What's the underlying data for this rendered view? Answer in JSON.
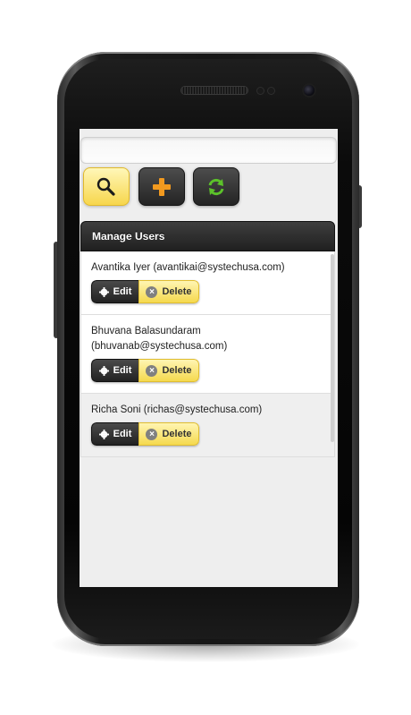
{
  "toolbar": {
    "search_icon": "search-icon",
    "add_icon": "plus-icon",
    "refresh_icon": "refresh-icon"
  },
  "panel": {
    "title": "Manage Users"
  },
  "users": [
    {
      "line1": "Avantika Iyer (avantikai@systechusa.com)",
      "line2": "",
      "edit_label": "Edit",
      "delete_label": "Delete"
    },
    {
      "line1": "Bhuvana Balasundaram",
      "line2": "(bhuvanab@systechusa.com)",
      "edit_label": "Edit",
      "delete_label": "Delete"
    },
    {
      "line1": "Richa Soni (richas@systechusa.com)",
      "line2": "",
      "edit_label": "Edit",
      "delete_label": "Delete"
    }
  ],
  "colors": {
    "accent_yellow": "#f7d64c",
    "dark_button": "#242424",
    "plus_orange": "#f29a1f",
    "refresh_green": "#5cc22a"
  }
}
